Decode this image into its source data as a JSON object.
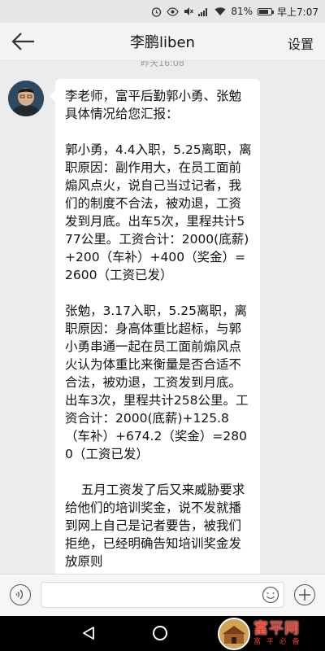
{
  "status_bar": {
    "battery": "81%",
    "battery_level": 0.81,
    "time": "早上7:07"
  },
  "header": {
    "title": "李鹏liben",
    "settings_label": "设置"
  },
  "chat": {
    "timestamp": "昨天16:08",
    "messages": [
      {
        "sender": "李鹏liben",
        "text": "李老师，富平后勤郭小勇、张勉具体情况给您汇报：\n\n郭小勇，4.4入职，5.25离职，离职原因：副作用大，在员工面前煽风点火，说自己当过记者，我们的制度不合法，被劝退，工资发到月底。出车5次，里程共计577公里。工资合计：2000(底薪)+200（车补）+400（奖金）=2600（工资已发）\n\n张勉，3.17入职，5.25离职，离职原因：身高体重比超标，与郭小勇串通一起在员工面前煽风点火认为体重比来衡量是否合适不合法，被劝退，工资发到月底。出车3次，里程共计258公里。工资合计：2000(底薪)+125.8（车补）+674.2（奖金）=2800（工资已发）\n\n    五月工资发了后又来威胁要求给他们的培训奖金，说不发就播到网上自己是记者要告，被我们拒绝，已经明确告知培训奖金发放原则"
      }
    ]
  },
  "watermark": {
    "main": "富平网",
    "sub": "富 平 必 备"
  }
}
